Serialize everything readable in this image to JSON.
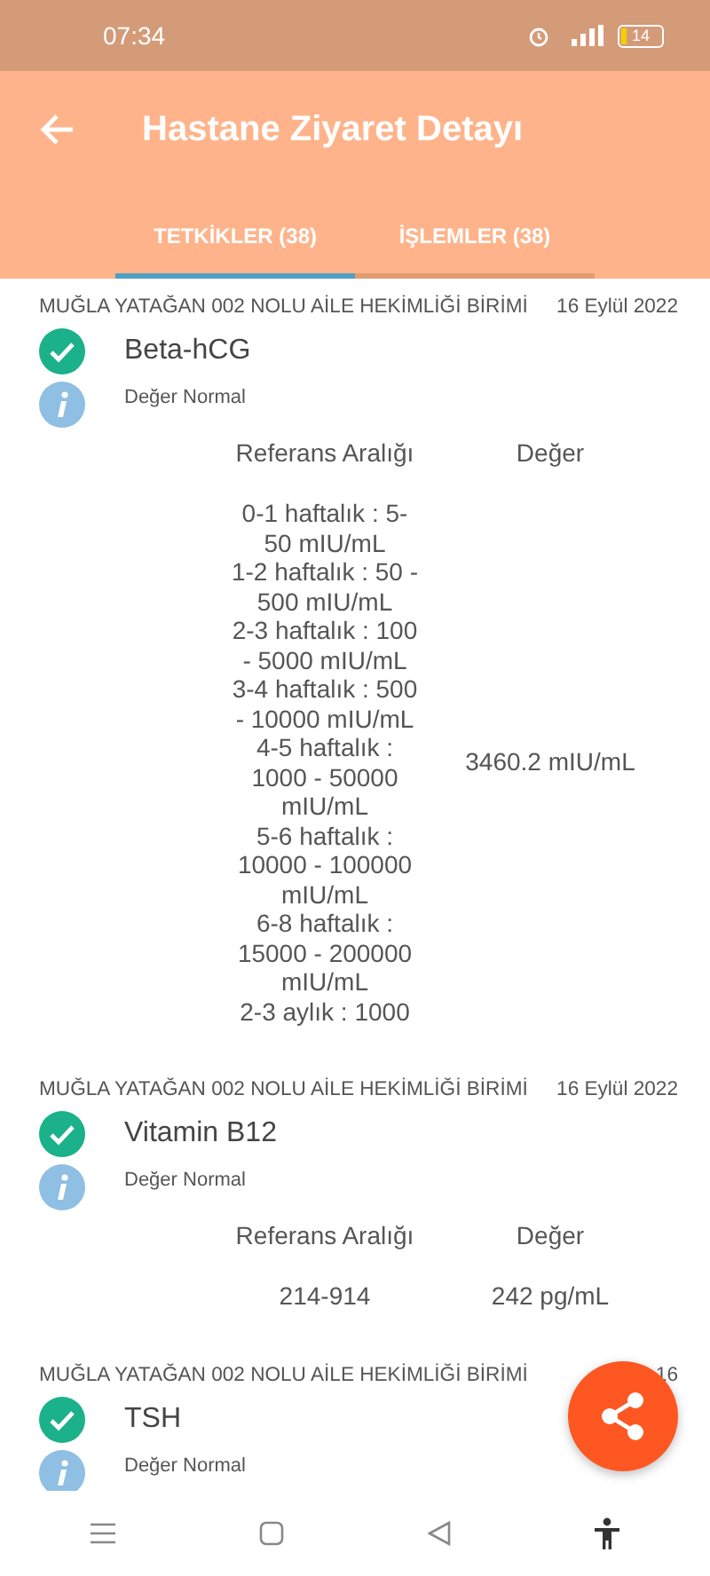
{
  "status_bar": {
    "time": "07:34",
    "battery": "14"
  },
  "header": {
    "title": "Hastane Ziyaret Detayı"
  },
  "tabs": [
    {
      "label": "TETKİKLER (38)",
      "selected": true
    },
    {
      "label": "İŞLEMLER (38)",
      "selected": false
    }
  ],
  "results": [
    {
      "source": "MUĞLA YATAĞAN 002 NOLU AİLE HEKİMLİĞİ BİRİMİ",
      "date": "16 Eylül 2022",
      "test": "Beta-hCG",
      "note": "Değer Normal",
      "table": {
        "reference_header": "Referans Aralığı",
        "value_header": "Değer",
        "reference": "0-1 haftalık : 5-\n50 mIU/mL\n1-2 haftalık : 50 -\n500 mIU/mL\n2-3 haftalık : 100\n- 5000 mIU/mL\n3-4 haftalık : 500\n- 10000 mIU/mL\n4-5 haftalık :\n1000 - 50000\nmIU/mL\n5-6 haftalık :\n10000 - 100000\nmIU/mL\n6-8 haftalık :\n15000 - 200000\nmIU/mL\n2-3 aylık    : 1000",
        "value": "3460.2 mIU/mL"
      }
    },
    {
      "source": "MUĞLA YATAĞAN 002 NOLU AİLE HEKİMLİĞİ BİRİMİ",
      "date": "16 Eylül 2022",
      "test": "Vitamin B12",
      "note": "Değer Normal",
      "table": {
        "reference_header": "Referans Aralığı",
        "value_header": "Değer",
        "reference": "214-914",
        "value": "242 pg/mL"
      }
    },
    {
      "source": "MUĞLA YATAĞAN 002 NOLU AİLE HEKİMLİĞİ BİRİMİ",
      "date": "16",
      "test": "TSH",
      "note": "Değer Normal"
    }
  ]
}
